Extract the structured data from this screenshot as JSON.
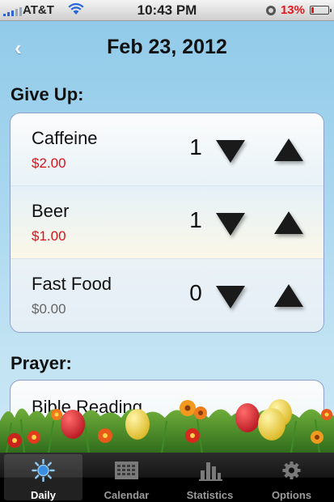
{
  "status_bar": {
    "carrier": "AT&T",
    "time": "10:43 PM",
    "battery_percent": "13%",
    "battery_level": 0.13
  },
  "header": {
    "back_glyph": "‹",
    "date": "Feb 23, 2012"
  },
  "give_up": {
    "title": "Give Up:",
    "items": [
      {
        "name": "Caffeine",
        "amount": "$2.00",
        "count": "1",
        "amount_color": "#d4161c"
      },
      {
        "name": "Beer",
        "amount": "$1.00",
        "count": "1",
        "amount_color": "#d4161c"
      },
      {
        "name": "Fast Food",
        "amount": "$0.00",
        "count": "0",
        "amount_color": "#666666"
      }
    ]
  },
  "prayer": {
    "title": "Prayer:",
    "items": [
      {
        "name": "Bible Reading"
      }
    ]
  },
  "tabs": [
    {
      "label": "Daily",
      "icon": "sun-icon",
      "active": true
    },
    {
      "label": "Calendar",
      "icon": "calendar-icon",
      "active": false
    },
    {
      "label": "Statistics",
      "icon": "bar-chart-icon",
      "active": false
    },
    {
      "label": "Options",
      "icon": "gear-icon",
      "active": false
    }
  ],
  "colors": {
    "accent_blue": "#2a66d8",
    "money_red": "#d4161c",
    "battery_red": "#e0191d"
  }
}
